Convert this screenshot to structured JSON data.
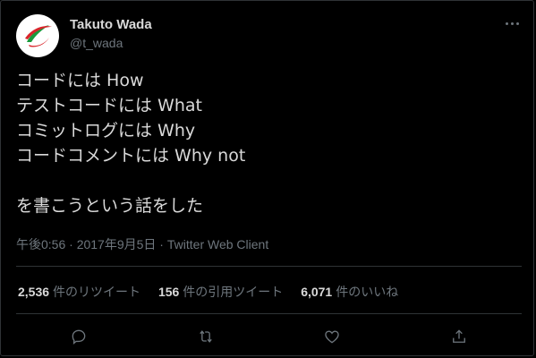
{
  "author": {
    "name": "Takuto Wada",
    "handle": "@t_wada"
  },
  "tweet": {
    "lines": [
      "コードには How",
      "テストコードには What",
      "コミットログには Why",
      "コードコメントには Why not",
      "",
      "を書こうという話をした"
    ],
    "time": "午後0:56",
    "sep1": " · ",
    "date": "2017年9月5日",
    "sep2": " · ",
    "source": "Twitter Web Client"
  },
  "stats": {
    "retweets": {
      "count": "2,536",
      "label": "件のリツイート"
    },
    "quotes": {
      "count": "156",
      "label": "件の引用ツイート"
    },
    "likes": {
      "count": "6,071",
      "label": "件のいいね"
    }
  },
  "icons": {
    "more": "more-options-icon",
    "reply": "reply-icon",
    "retweet": "retweet-icon",
    "like": "heart-icon",
    "share": "share-icon"
  },
  "colors": {
    "background": "#000000",
    "text": "#d9d9d9",
    "muted": "#6e767d",
    "divider": "#2f3336",
    "logo_red": "#d9252b",
    "logo_green": "#1a9a3c"
  }
}
